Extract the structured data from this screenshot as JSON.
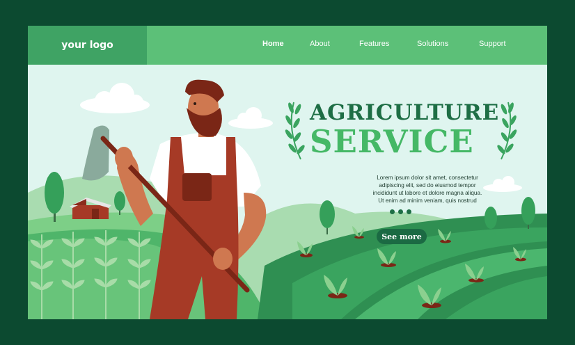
{
  "header": {
    "logo": "your logo",
    "nav": [
      "Home",
      "About",
      "Features",
      "Solutions",
      "Support"
    ],
    "active": "Home"
  },
  "hero": {
    "title_line1": "AGRICULTURE",
    "title_line2": "SERVICE",
    "description_lines": [
      "Lorem ipsum dolor sit amet, consectetur",
      "adipiscing elit, sed do eiusmod tempor",
      "incididunt ut labore et dolore magna aliqua.",
      "Ut enim ad minim veniam, quis nostrud"
    ],
    "cta": "See more",
    "carousel": {
      "total": 3,
      "active": 1
    }
  },
  "colors": {
    "page_bg": "#0c4a30",
    "header_bg": "#5cc078",
    "logo_bg": "#3fa364",
    "sky": "#dff5ef",
    "title_dark": "#1e6e45",
    "title_light": "#45b866",
    "button": "#1b6a43",
    "overalls": "#a63a26"
  },
  "icons": [
    "laurel-icon",
    "cloud-icon",
    "tree-icon",
    "barn-icon",
    "sprout-icon",
    "hoe-icon"
  ]
}
